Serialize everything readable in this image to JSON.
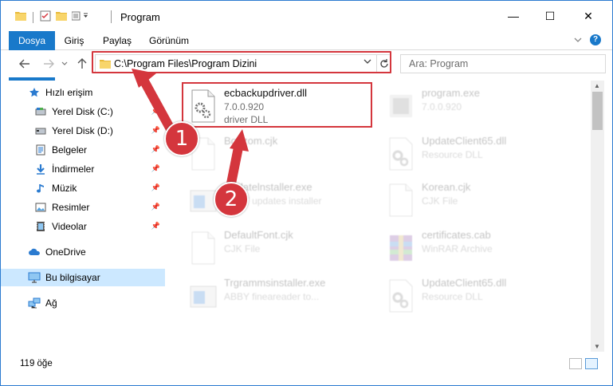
{
  "window": {
    "title": "Program"
  },
  "ribbon": {
    "tabs": [
      "Dosya",
      "Giriş",
      "Paylaş",
      "Görünüm"
    ],
    "expand_icon": "chevron-down-icon",
    "help_label": "?"
  },
  "window_controls": {
    "minimize": "—",
    "maximize": "☐",
    "close": "✕"
  },
  "navbar": {
    "address_path": "C:\\Program Files\\Program Dizini",
    "search_placeholder": "Ara: Program"
  },
  "sidebar": {
    "quick_access": "Hızlı erişim",
    "items": [
      {
        "label": "Yerel Disk (C:)",
        "icon": "drive-icon",
        "pinned": true
      },
      {
        "label": "Yerel Disk (D:)",
        "icon": "drive-icon",
        "pinned": true
      },
      {
        "label": "Belgeler",
        "icon": "documents-icon",
        "pinned": true
      },
      {
        "label": "İndirmeler",
        "icon": "download-icon",
        "pinned": true
      },
      {
        "label": "Müzik",
        "icon": "music-icon",
        "pinned": true
      },
      {
        "label": "Resimler",
        "icon": "pictures-icon",
        "pinned": true
      },
      {
        "label": "Videolar",
        "icon": "videos-icon",
        "pinned": true
      }
    ],
    "onedrive": "OneDrive",
    "this_pc": "Bu bilgisayar",
    "network": "Ağ"
  },
  "files": [
    {
      "name": "ecbackupdriver.dll",
      "line2": "7.0.0.920",
      "line3": "driver DLL",
      "icon": "dll-gear-icon",
      "highlighted": true
    },
    {
      "name": "program.exe",
      "line2": "7.0.0.920",
      "line3": "",
      "icon": "exe-icon"
    },
    {
      "name": "Bonzom.cjk",
      "line2": "",
      "line3": "",
      "icon": "file-icon"
    },
    {
      "name": "UpdateClient65.dll",
      "line2": "Resource DLL",
      "line3": "",
      "icon": "dll-gear-icon"
    },
    {
      "name": "Updatelnstaller.exe",
      "line2": "ABBY updates installer",
      "line3": "",
      "icon": "installer-icon"
    },
    {
      "name": "Korean.cjk",
      "line2": "CJK File",
      "line3": "",
      "icon": "file-icon"
    },
    {
      "name": "DefaultFont.cjk",
      "line2": "CJK File",
      "line3": "",
      "icon": "file-icon"
    },
    {
      "name": "certificates.cab",
      "line2": "WinRAR Archive",
      "line3": "",
      "icon": "winrar-icon"
    },
    {
      "name": "Trgrammsinstaller.exe",
      "line2": "ABBY fineareader to...",
      "line3": "",
      "icon": "installer-icon"
    },
    {
      "name": "UpdateClient65.dll",
      "line2": "Resource DLL",
      "line3": "",
      "icon": "dll-gear-icon"
    }
  ],
  "annotations": [
    "1",
    "2"
  ],
  "status": {
    "item_count": "119 öğe"
  },
  "colors": {
    "accent": "#1979ca",
    "highlight_red": "#d4363d",
    "selected_bg": "#cce8ff"
  }
}
